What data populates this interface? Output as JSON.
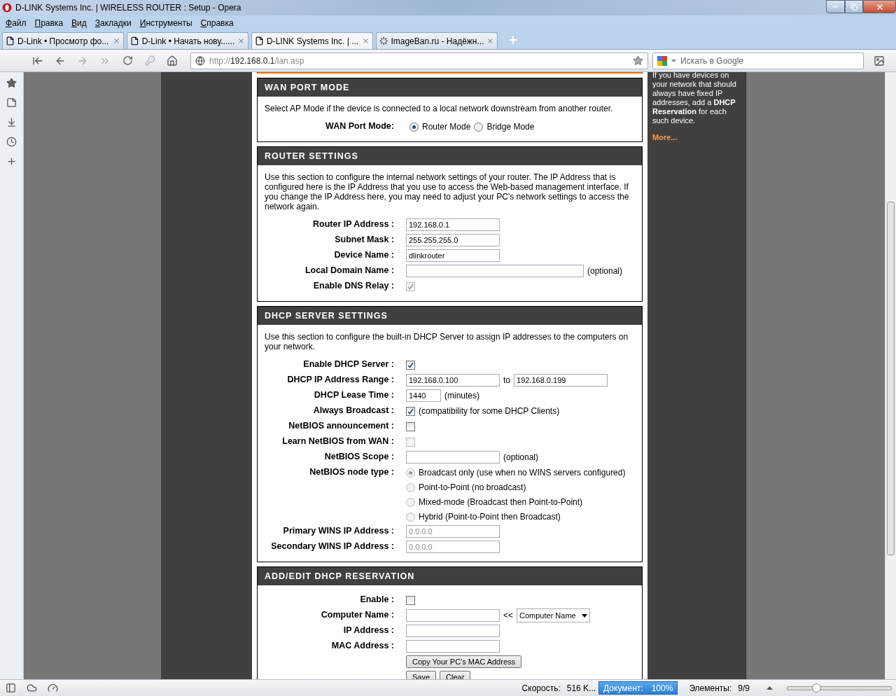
{
  "window": {
    "title": "D-LINK Systems Inc. | WIRELESS ROUTER : Setup - Opera"
  },
  "menu": [
    "Файл",
    "Правка",
    "Вид",
    "Закладки",
    "Инструменты",
    "Справка"
  ],
  "tabs": [
    {
      "label": "D-Link • Просмотр фо...",
      "selected": false,
      "loading": false
    },
    {
      "label": "D-Link • Начать нову......",
      "selected": false,
      "loading": false
    },
    {
      "label": "D-LINK Systems Inc. | ...",
      "selected": true,
      "loading": false
    },
    {
      "label": "ImageBan.ru - Надёжн...",
      "selected": false,
      "loading": true
    }
  ],
  "address": {
    "scheme": "http://",
    "host": "192.168.0.1",
    "path": "/lan.asp"
  },
  "search": {
    "placeholder": "Искать в Google"
  },
  "sections": [
    {
      "title": "WAN PORT MODE",
      "description": "Select AP Mode if the device is connected to a local network downstream from another router.",
      "rows": [
        {
          "kind": "radio-inline",
          "label": "WAN Port Mode:",
          "options": [
            {
              "label": "Router Mode",
              "selected": true
            },
            {
              "label": "Bridge Mode",
              "selected": false
            }
          ]
        }
      ]
    },
    {
      "title": "ROUTER SETTINGS",
      "description": "Use this section to configure the internal network settings of your router. The IP Address that is configured here is the IP Address that you use to access the Web-based management interface. If you change the IP Address here, you may need to adjust your PC's network settings to access the network again.",
      "rows": [
        {
          "kind": "text",
          "label": "Router IP Address :",
          "value": "192.168.0.1"
        },
        {
          "kind": "text",
          "label": "Subnet Mask :",
          "value": "255.255.255.0"
        },
        {
          "kind": "text",
          "label": "Device Name :",
          "value": "dlinkrouter"
        },
        {
          "kind": "wide-text",
          "label": "Local Domain Name :",
          "suffix": "(optional)"
        },
        {
          "kind": "checkbox",
          "label": "Enable DNS Relay :",
          "checked": true,
          "disabled": true
        }
      ]
    },
    {
      "title": "DHCP SERVER SETTINGS",
      "description": "Use this section to configure the built-in DHCP Server to assign IP addresses to the computers on your network.",
      "rows": [
        {
          "kind": "checkbox",
          "label": "Enable DHCP Server :",
          "checked": true,
          "disabled": false
        },
        {
          "kind": "range",
          "label": "DHCP IP Address Range :",
          "from": "192.168.0.100",
          "joiner": "to",
          "to": "192.168.0.199"
        },
        {
          "kind": "short-text",
          "label": "DHCP Lease Time :",
          "value": "1440",
          "suffix": "(minutes)"
        },
        {
          "kind": "checkbox",
          "label": "Always Broadcast :",
          "checked": true,
          "disabled": false,
          "suffix": "(compatibility for some DHCP Clients)"
        },
        {
          "kind": "checkbox",
          "label": "NetBIOS announcement :",
          "checked": false,
          "disabled": false
        },
        {
          "kind": "checkbox",
          "label": "Learn NetBIOS from WAN :",
          "checked": false,
          "disabled": true
        },
        {
          "kind": "text",
          "label": "NetBIOS Scope :",
          "suffix": "(optional)"
        },
        {
          "kind": "radio-group",
          "label": "NetBIOS node type :",
          "disabled": true,
          "options": [
            {
              "label": "Broadcast only (use when no WINS servers configured)",
              "selected": true
            },
            {
              "label": "Point-to-Point (no broadcast)",
              "selected": false
            },
            {
              "label": "Mixed-mode (Broadcast then Point-to-Point)",
              "selected": false
            },
            {
              "label": "Hybrid (Point-to-Point then Broadcast)",
              "selected": false
            }
          ]
        },
        {
          "kind": "text",
          "label": "Primary WINS IP Address :",
          "value": "0.0.0.0",
          "disabled": true
        },
        {
          "kind": "text",
          "label": "Secondary WINS IP Address :",
          "value": "0.0.0.0",
          "disabled": true
        }
      ]
    },
    {
      "title": "ADD/EDIT DHCP RESERVATION",
      "rows": [
        {
          "kind": "checkbox",
          "label": "Enable :",
          "checked": false,
          "disabled": false
        },
        {
          "kind": "combo",
          "label": "Computer Name :",
          "joiner": "<<",
          "select": "Computer Name"
        },
        {
          "kind": "text",
          "label": "IP Address :"
        },
        {
          "kind": "text",
          "label": "MAC Address :"
        },
        {
          "kind": "buttons",
          "buttons": [
            "Copy Your PC's MAC Address"
          ]
        },
        {
          "kind": "buttons",
          "buttons": [
            "Save",
            "Clear"
          ]
        }
      ]
    }
  ],
  "hint": {
    "text": "If you have devices on your network that should always have fixed IP addresses, add a **DHCP Reservation** for each such device.",
    "link": "More..."
  },
  "status_bar": {
    "speed_label": "Скорость:",
    "speed": "516 K...",
    "document_progress": {
      "label": "Документ:",
      "value": "100%",
      "level": 1
    },
    "elements_label": "Элементы:",
    "elements": "9/9",
    "zoom": {
      "level": 0.28
    }
  }
}
